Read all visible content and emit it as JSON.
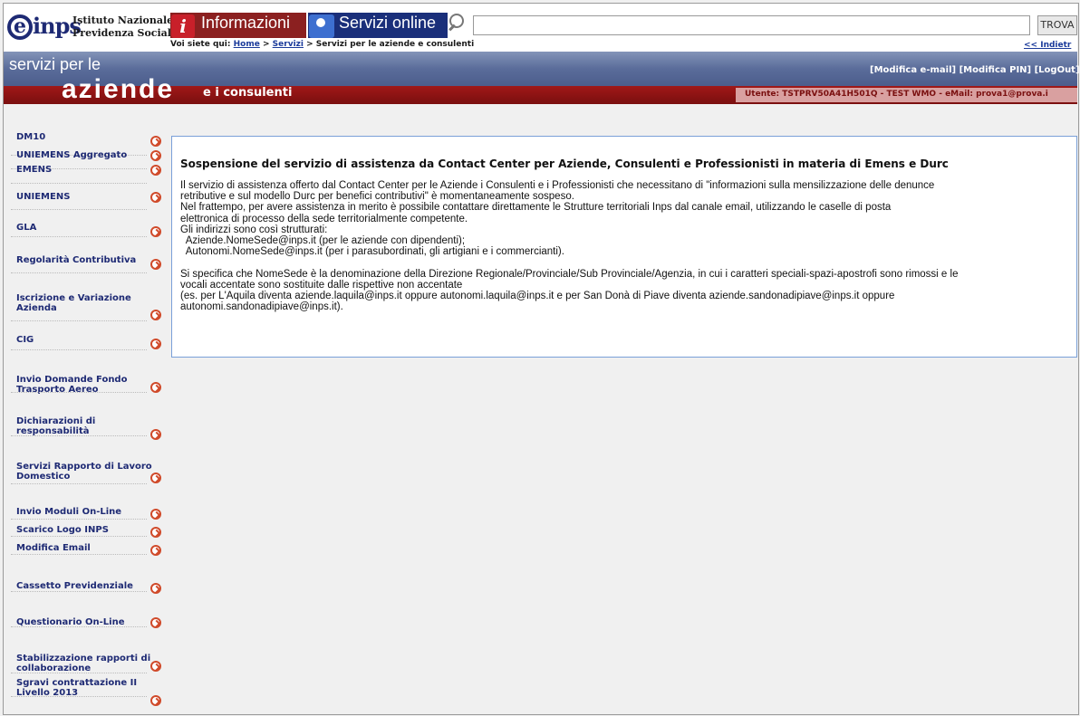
{
  "header": {
    "logo_mark": "inps",
    "logo_line1": "Istituto Nazionale",
    "logo_line2": "Previdenza Sociale",
    "tab_informazioni": "Informazioni",
    "tab_servizi": "Servizi online",
    "search_placeholder": "",
    "search_button": "TROVA",
    "breadcrumb_prefix": "Voi siete qui:",
    "breadcrumb_home": "Home",
    "breadcrumb_servizi": "Servizi",
    "breadcrumb_current": "> Servizi per le aziende e consulenti",
    "back_link": "<< Indietr"
  },
  "banner": {
    "line1": "servizi per le",
    "line2": "aziende",
    "line3": "e i consulenti",
    "link_email": "[Modifica e-mail]",
    "link_pin": "[Modifica PIN]",
    "link_logout": "[LogOut]",
    "user_info": "Utente: TSTPRV50A41H501Q - TEST WMO - eMail: prova1@prova.i"
  },
  "sidebar": {
    "items": [
      "DM10",
      "UNIEMENS Aggregato",
      "EMENS",
      "UNIEMENS",
      "GLA",
      "Regolarità Contributiva",
      "Iscrizione e Variazione Azienda",
      "CIG",
      "Invio Domande Fondo Trasporto Aereo",
      "Dichiarazioni di responsabilità",
      "Servizi Rapporto di Lavoro Domestico",
      "Invio Moduli On-Line",
      "Scarico Logo INPS",
      "Modifica Email",
      "Cassetto Previdenziale",
      "Questionario On-Line",
      "Stabilizzazione rapporti di collaborazione",
      "Sgravi contrattazione II Livello 2013"
    ]
  },
  "content": {
    "title": "Sospensione del servizio di assistenza da Contact Center per Aziende, Consulenti e Professionisti in materia di Emens e Durc",
    "lines": [
      "Il servizio di assistenza offerto dal Contact Center per le Aziende i Consulenti e i Professionisti che necessitano di \"informazioni sulla mensilizzazione delle denunce",
      "retributive e sul modello Durc per benefici contributivi\" è momentaneamente sospeso.",
      "Nel frattempo, per avere assistenza in merito è possibile contattare direttamente le Strutture territoriali Inps dal canale email, utilizzando le caselle di posta",
      "elettronica di processo della sede territorialmente competente.",
      "Gli indirizzi sono così strutturati:",
      "  Aziende.NomeSede@inps.it (per le aziende con dipendenti);",
      "  Autonomi.NomeSede@inps.it (per i parasubordinati, gli artigiani e i commercianti).",
      "",
      "Si specifica che NomeSede è la denominazione della Direzione Regionale/Provinciale/Sub Provinciale/Agenzia, in cui i caratteri speciali-spazi-apostrofi sono rimossi e le",
      "vocali accentate sono sostituite dalle rispettive non accentate",
      "(es. per L'Aquila diventa aziende.laquila@inps.it oppure autonomi.laquila@inps.it e per San Donà di Piave diventa aziende.sandonadipiave@inps.it oppure",
      "autonomi.sandonadipiave@inps.it)."
    ]
  }
}
